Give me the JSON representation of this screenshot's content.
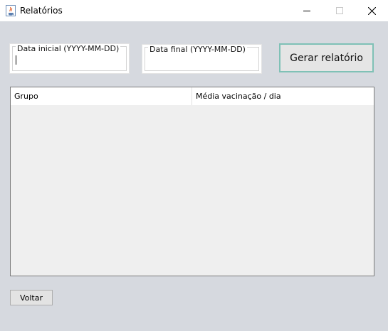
{
  "window": {
    "title": "Relatórios",
    "icon": "java-cup-icon"
  },
  "form": {
    "start_date": {
      "label": "Data inicial (YYYY-MM-DD)",
      "value": ""
    },
    "end_date": {
      "label": "Data final (YYYY-MM-DD)",
      "value": ""
    },
    "generate_label": "Gerar relatório"
  },
  "table": {
    "columns": [
      "Grupo",
      "Média vacinação / dia"
    ],
    "rows": []
  },
  "back_label": "Voltar",
  "colors": {
    "focus_border": "#7fc1b6",
    "window_bg": "#d6d9df"
  }
}
